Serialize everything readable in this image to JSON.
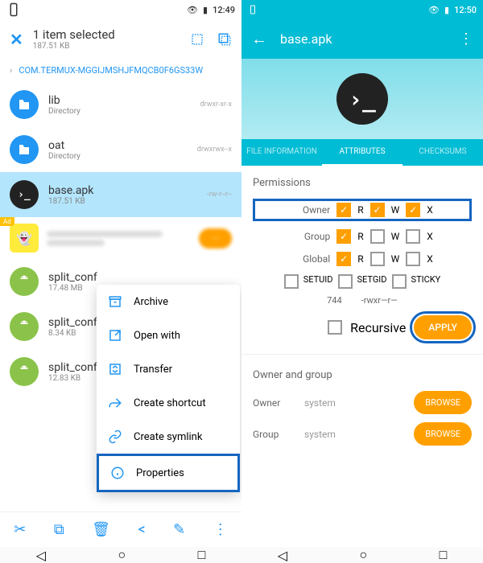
{
  "left": {
    "status": {
      "time": "12:49"
    },
    "selection": {
      "title": "1 item selected",
      "size": "187.51 KB"
    },
    "breadcrumb": "COM.TERMUX-MGGIJMSHJFMQCB0F6GS33W",
    "files": [
      {
        "name": "lib",
        "sub": "Directory",
        "perm": "drwxr-xr-x",
        "icon": "folder"
      },
      {
        "name": "oat",
        "sub": "Directory",
        "perm": "drwxrwx--x",
        "icon": "folder"
      },
      {
        "name": "base.apk",
        "sub": "187.51 KB",
        "perm": "-rw-r--r--",
        "icon": "terminal",
        "selected": true
      },
      {
        "name": "split_conf",
        "sub": "17.48 MB",
        "perm": "",
        "icon": "android"
      },
      {
        "name": "split_conf",
        "sub": "8.34 KB",
        "perm": "",
        "icon": "android"
      },
      {
        "name": "split_conf",
        "sub": "12.83 KB",
        "perm": "",
        "icon": "android"
      }
    ],
    "ad": {
      "badge": "Ad"
    },
    "menu": [
      {
        "label": "Archive",
        "icon": "archive-icon"
      },
      {
        "label": "Open with",
        "icon": "open-external-icon"
      },
      {
        "label": "Transfer",
        "icon": "transfer-icon"
      },
      {
        "label": "Create shortcut",
        "icon": "shortcut-icon"
      },
      {
        "label": "Create symlink",
        "icon": "link-icon"
      },
      {
        "label": "Properties",
        "icon": "info-icon",
        "highlighted": true
      }
    ]
  },
  "right": {
    "status": {
      "time": "12:50"
    },
    "title": "base.apk",
    "tabs": [
      "FILE INFORMATION",
      "ATTRIBUTES",
      "CHECKSUMS"
    ],
    "activeTab": 1,
    "permissions": {
      "title": "Permissions",
      "rows": [
        {
          "label": "Owner",
          "r": true,
          "w": true,
          "x": true,
          "highlighted": true
        },
        {
          "label": "Group",
          "r": true,
          "w": false,
          "x": false
        },
        {
          "label": "Global",
          "r": true,
          "w": false,
          "x": false
        }
      ],
      "special": [
        {
          "label": "SETUID",
          "checked": false
        },
        {
          "label": "SETGID",
          "checked": false
        },
        {
          "label": "STICKY",
          "checked": false
        }
      ],
      "octal": "744",
      "symbolic": "-rwxr—r—",
      "recursive": {
        "label": "Recursive",
        "checked": false
      },
      "applyLabel": "APPLY"
    },
    "ownerGroup": {
      "title": "Owner and group",
      "owner": {
        "label": "Owner",
        "value": "system",
        "browse": "BROWSE"
      },
      "group": {
        "label": "Group",
        "value": "system",
        "browse": "BROWSE"
      }
    }
  }
}
